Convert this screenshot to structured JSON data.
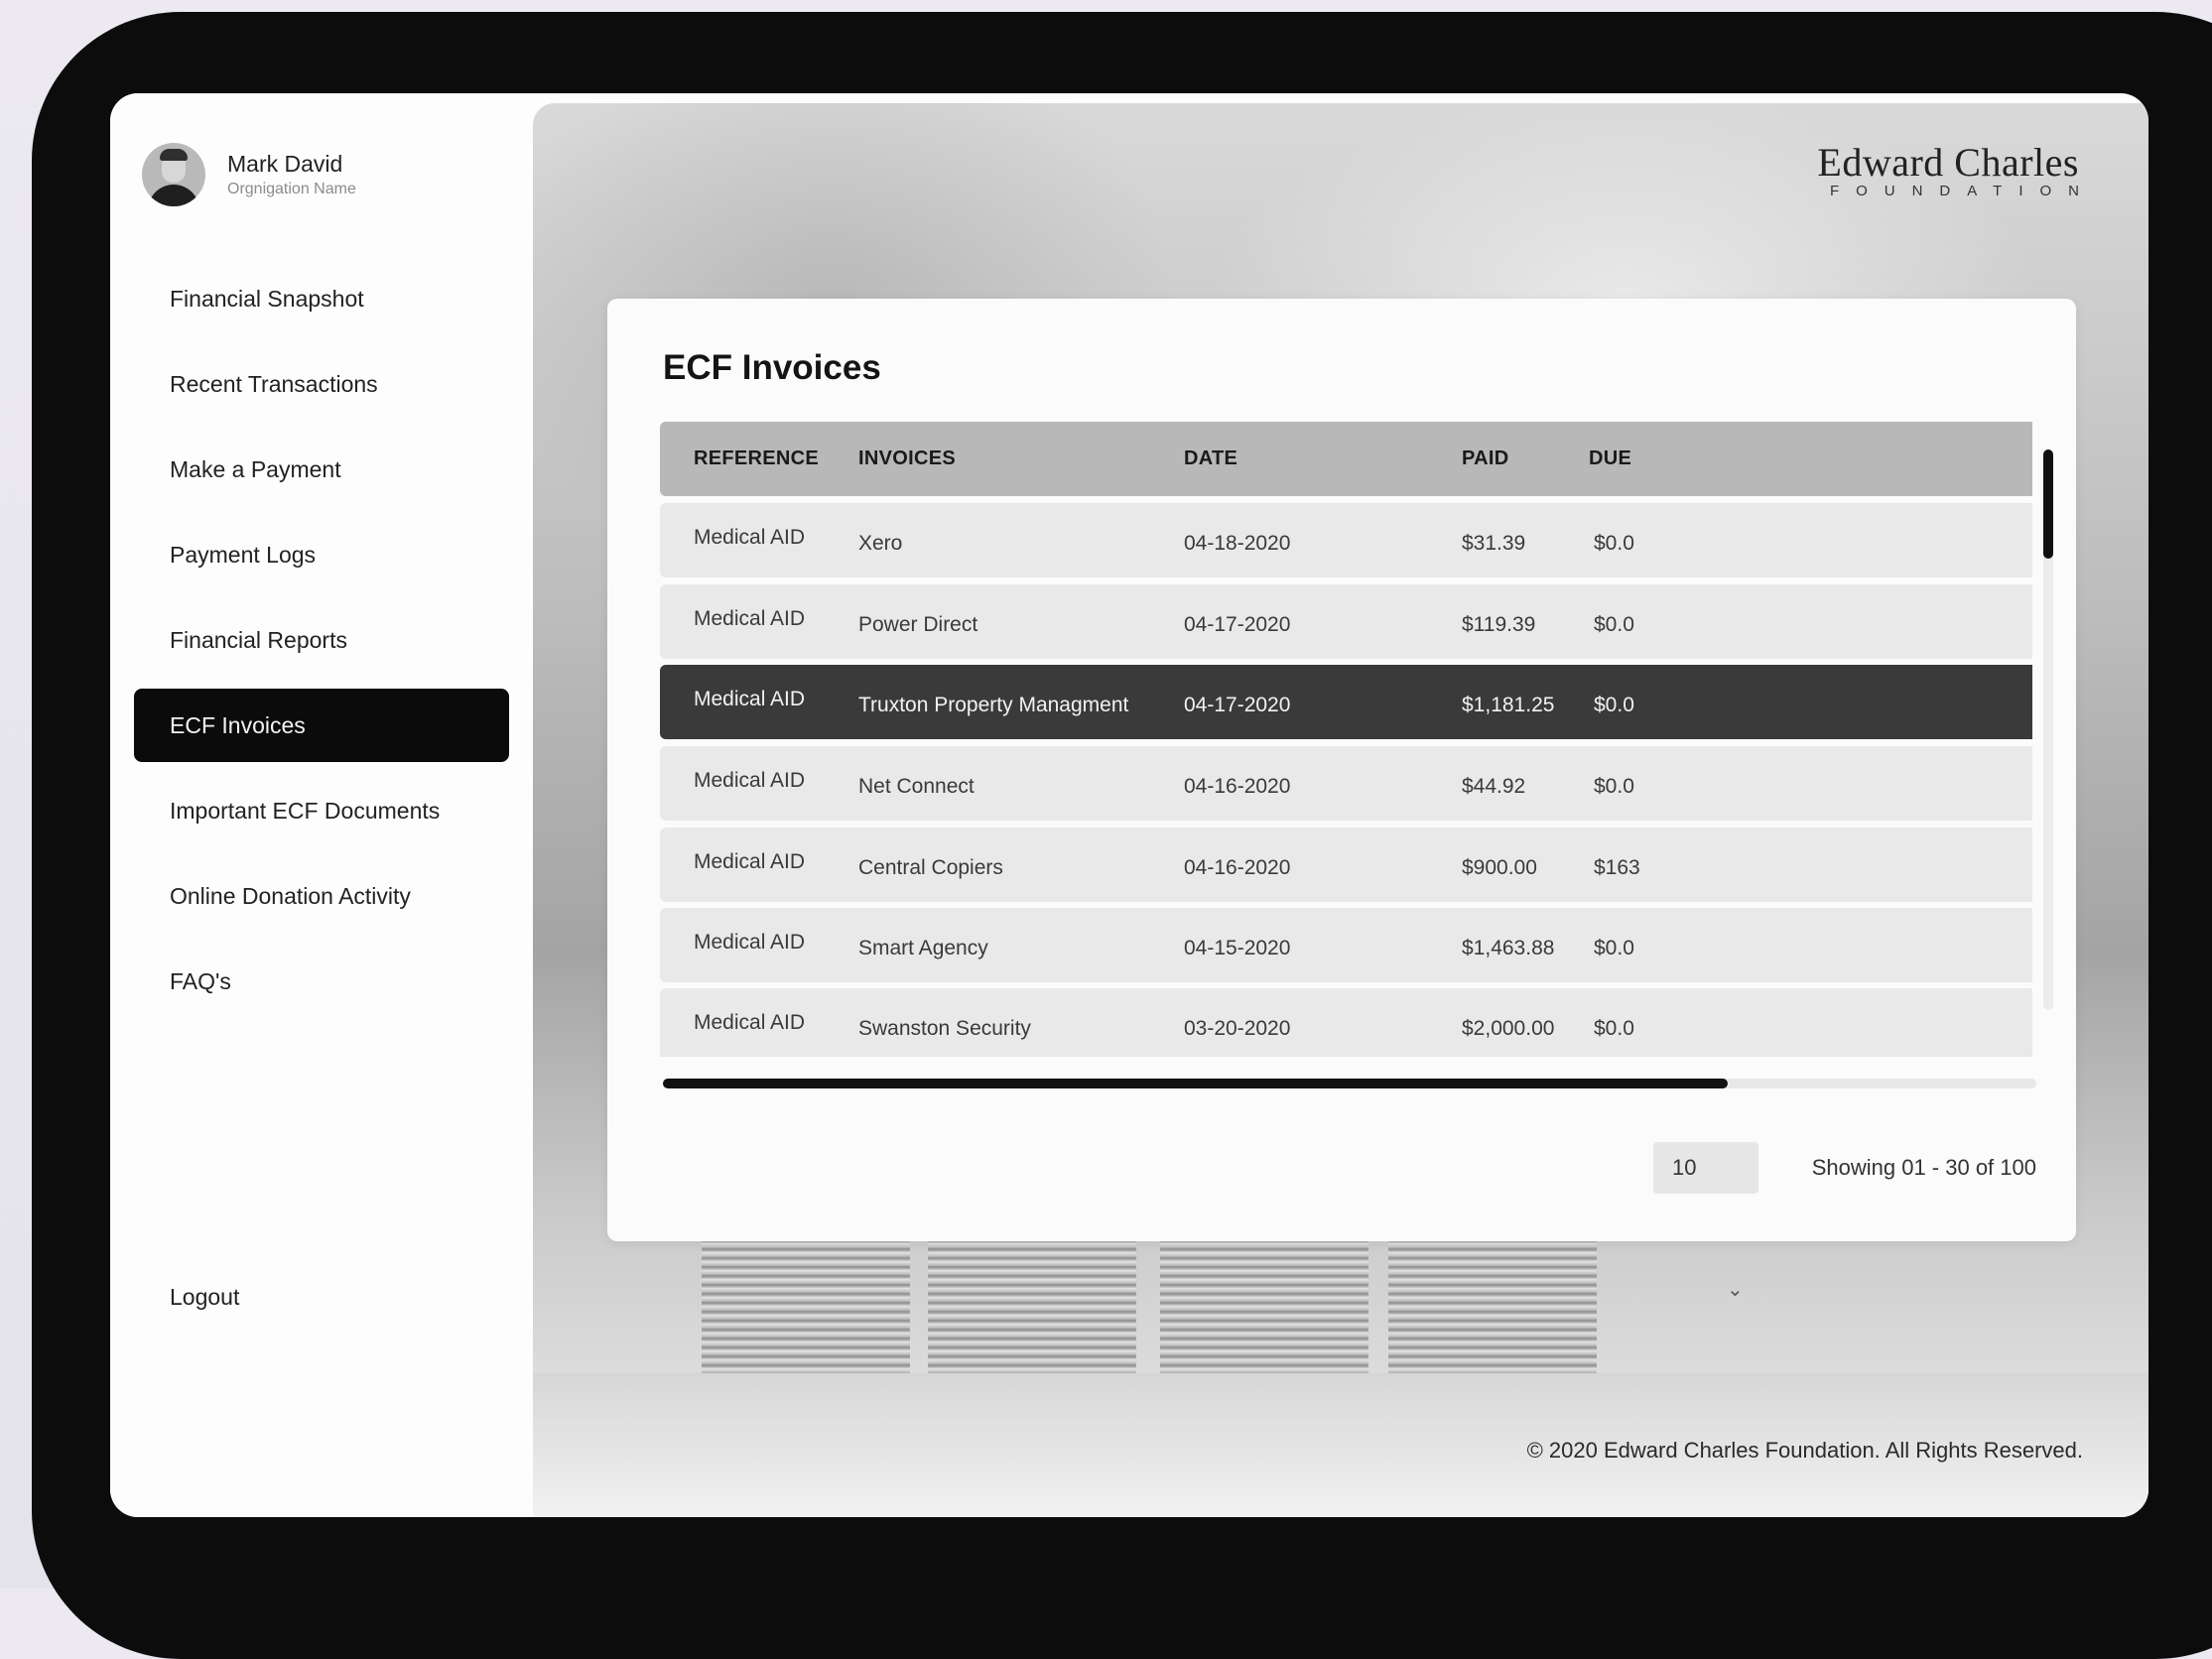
{
  "user": {
    "name": "Mark David",
    "organization": "Orgnigation Name"
  },
  "brand": {
    "name": "Edward Charles",
    "subtitle": "FOUNDATION"
  },
  "nav": {
    "items": [
      {
        "label": "Financial Snapshot",
        "active": false
      },
      {
        "label": "Recent Transactions",
        "active": false
      },
      {
        "label": "Make a Payment",
        "active": false
      },
      {
        "label": "Payment Logs",
        "active": false
      },
      {
        "label": "Financial Reports",
        "active": false
      },
      {
        "label": "ECF Invoices",
        "active": true
      },
      {
        "label": "Important ECF Documents",
        "active": false
      },
      {
        "label": "Online Donation Activity",
        "active": false
      },
      {
        "label": "FAQ's",
        "active": false
      }
    ],
    "logout": "Logout"
  },
  "page": {
    "title": "ECF Invoices"
  },
  "table": {
    "columns": [
      "REFERENCE",
      "INVOICES",
      "DATE",
      "PAID",
      "DUE"
    ],
    "rows": [
      {
        "reference": "Medical AID",
        "invoice": "Xero",
        "date": "04-18-2020",
        "paid": "$31.39",
        "due": "$0.0"
      },
      {
        "reference": "Medical AID",
        "invoice": "Power Direct",
        "date": "04-17-2020",
        "paid": "$119.39",
        "due": "$0.0"
      },
      {
        "reference": "Medical AID",
        "invoice": "Truxton Property Managment",
        "date": "04-17-2020",
        "paid": "$1,181.25",
        "due": "$0.0"
      },
      {
        "reference": "Medical AID",
        "invoice": "Net Connect",
        "date": "04-16-2020",
        "paid": "$44.92",
        "due": "$0.0"
      },
      {
        "reference": "Medical AID",
        "invoice": "Central Copiers",
        "date": "04-16-2020",
        "paid": "$900.00",
        "due": "$163"
      },
      {
        "reference": "Medical AID",
        "invoice": "Smart Agency",
        "date": "04-15-2020",
        "paid": "$1,463.88",
        "due": "$0.0"
      },
      {
        "reference": "Medical AID",
        "invoice": "Swanston Security",
        "date": "03-20-2020",
        "paid": "$2,000.00",
        "due": "$0.0"
      }
    ],
    "selected_row": 2
  },
  "pagination": {
    "per_page": "10",
    "showing": "Showing 01 - 30 of 100"
  },
  "footer": {
    "copyright": "© 2020 Edward Charles Foundation. All Rights Reserved."
  }
}
